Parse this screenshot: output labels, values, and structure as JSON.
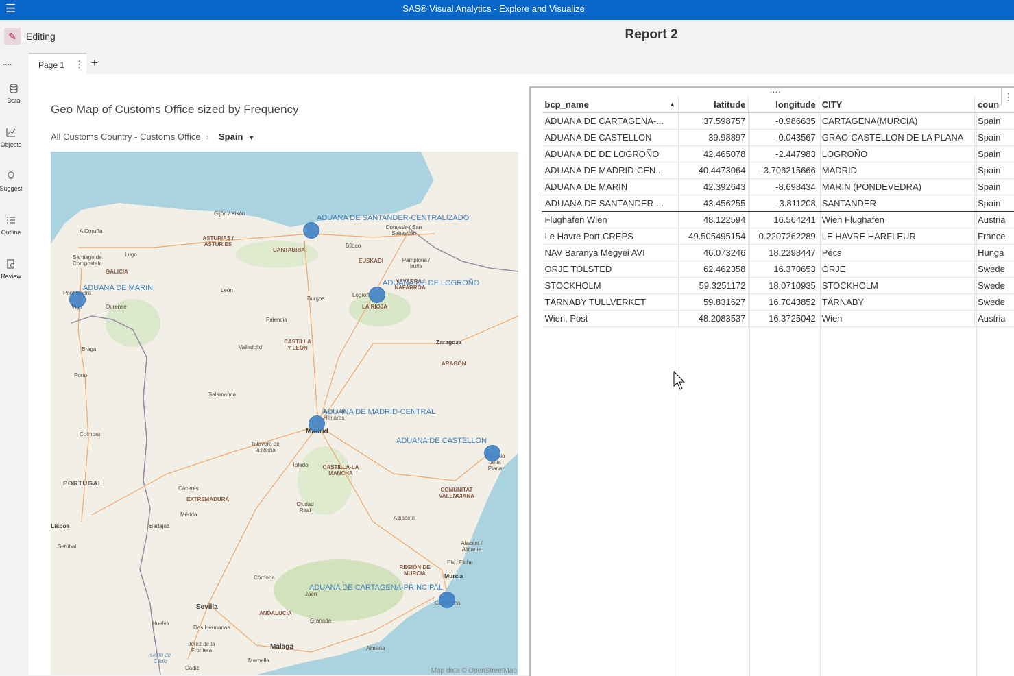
{
  "app": {
    "title": "SAS® Visual Analytics - Explore and Visualize"
  },
  "editbar": {
    "mode_label": "Editing",
    "report_title": "Report 2"
  },
  "leftnav": {
    "overflow": "....",
    "items": [
      {
        "label": "Data",
        "icon": "database-icon"
      },
      {
        "label": "Objects",
        "icon": "chart-icon"
      },
      {
        "label": "Suggest",
        "icon": "lightbulb-icon"
      },
      {
        "label": "Outline",
        "icon": "list-icon"
      },
      {
        "label": "Review",
        "icon": "review-icon"
      }
    ]
  },
  "tabs": {
    "page": "Page 1",
    "page_menu": "⋮",
    "add": "+"
  },
  "map": {
    "title": "Geo Map of Customs Office sized by Frequency",
    "breadcrumb_root": "All Customs Country - Customs Office",
    "breadcrumb_separator": "›",
    "breadcrumb_selected": "Spain",
    "attribution": "Map data © OpenStreetMap",
    "offices": [
      {
        "label": "ADUANA DE SANTANDER-CENTRALIZADO"
      },
      {
        "label": "ADUANA DE MARIN"
      },
      {
        "label": "ADUANA DE DE LOGROÑO"
      },
      {
        "label": "ADUANA DE MADRID-CENTRAL"
      },
      {
        "label": "ADUANA DE CASTELLON"
      },
      {
        "label": "ADUANA DE CARTAGENA-PRINCIPAL"
      }
    ],
    "places": {
      "gijon": "Gijón / Xixón",
      "coruna": "A Coruña",
      "santiago": "Santiago de Compostela",
      "lugo": "Lugo",
      "galicia": "GALICIA",
      "asturias": "ASTURIAS / ASTURIES",
      "santander": "Santander",
      "cantabria": "CANTABRIA",
      "bilbao": "Bilbao",
      "donostia": "Donostia / San Sebastián",
      "euskadi": "EUSKADI",
      "pamplona": "Pamplona / Iruña",
      "navarra": "NAVARRA / NAFARROA",
      "logrono": "Logroño",
      "larioja": "LA RIOJA",
      "pontevedra": "Pontevedra",
      "vigo": "Vigo",
      "ourense": "Ourense",
      "leon": "León",
      "burgos": "Burgos",
      "palencia": "Palencia",
      "valladolid": "Valladolid",
      "castillaleon": "CASTILLA Y LEÓN",
      "zaragoza": "Zaragoza",
      "aragon": "ARAGÓN",
      "braga": "Braga",
      "porto": "Porto",
      "salamanca": "Salamanca",
      "alcala": "Alcalá de Henares",
      "madrid": "Madrid",
      "coimbra": "Coimbra",
      "talavera": "Talavera de la Reina",
      "toledo": "Toledo",
      "castillamancha": "CASTILLA-LA MANCHA",
      "castellon": "Castelló de la Plana",
      "portugal": "PORTUGAL",
      "caceres": "Cáceres",
      "extremadura": "EXTREMADURA",
      "valenciana": "COMUNITAT VALENCIANA",
      "merida": "Mérida",
      "ciudadreal": "Ciudad Real",
      "lisboa": "Lisboa",
      "badajoz": "Badajoz",
      "albacete": "Albacete",
      "setubal": "Setúbal",
      "alicante": "Alacant / Alicante",
      "murcia_region": "REGIÓN DE MURCIA",
      "elche": "Elx / Elche",
      "cordoba": "Córdoba",
      "murcia": "Murcia",
      "jaen": "Jaén",
      "cartagena": "Cartagena",
      "sevilla": "Sevilla",
      "andalucia": "ANDALUCÍA",
      "doshermanas": "Dos Hermanas",
      "granada": "Granada",
      "huelva": "Huelva",
      "jerez": "Jerez de la Frontera",
      "malaga": "Málaga",
      "almeria": "Almería",
      "golfo": "Golfo de Cádiz",
      "marbella": "Marbella",
      "cadiz": "Cádiz"
    }
  },
  "table": {
    "drag_handle": "....",
    "more": "⋮",
    "sort_indicator": "▲",
    "columns": [
      "bcp_name",
      "latitude",
      "longitude",
      "CITY",
      "coun"
    ],
    "rows": [
      [
        "ADUANA DE CARTAGENA-...",
        "37.598757",
        "-0.986635",
        "CARTAGENA(MURCIA)",
        "Spain"
      ],
      [
        "ADUANA DE CASTELLON",
        "39.98897",
        "-0.043567",
        "GRAO-CASTELLON DE LA PLANA",
        "Spain"
      ],
      [
        "ADUANA DE DE LOGROÑO",
        "42.465078",
        "-2.447983",
        "LOGROÑO",
        "Spain"
      ],
      [
        "ADUANA DE MADRID-CEN...",
        "40.4473064",
        "-3.706215666",
        "MADRID",
        "Spain"
      ],
      [
        "ADUANA DE MARIN",
        "42.392643",
        "-8.698434",
        "MARIN (PONDEVEDRA)",
        "Spain"
      ],
      [
        "ADUANA DE SANTANDER-...",
        "43.456255",
        "-3.811208",
        "SANTANDER",
        "Spain"
      ],
      [
        "Flughafen Wien",
        "48.122594",
        "16.564241",
        "Wien Flughafen",
        "Austria"
      ],
      [
        "Le Havre Port-CREPS",
        "49.505495154",
        "0.2207262289",
        "LE HAVRE HARFLEUR",
        "France"
      ],
      [
        "NAV Baranya Megyei AVI",
        "46.073246",
        "18.2298447",
        "Pécs",
        "Hunga"
      ],
      [
        "ORJE TOLSTED",
        "62.462358",
        "16.370653",
        "ÖRJE",
        "Swede"
      ],
      [
        "STOCKHOLM",
        "59.3251172",
        "18.0710935",
        "STOCKHOLM",
        "Swede"
      ],
      [
        "TÄRNABY TULLVERKET",
        "59.831627",
        "16.7043852",
        "TÄRNABY",
        "Swede"
      ],
      [
        "Wien, Post",
        "48.2083537",
        "16.3725042",
        "Wien",
        "Austria"
      ]
    ],
    "selected_row": 5
  }
}
